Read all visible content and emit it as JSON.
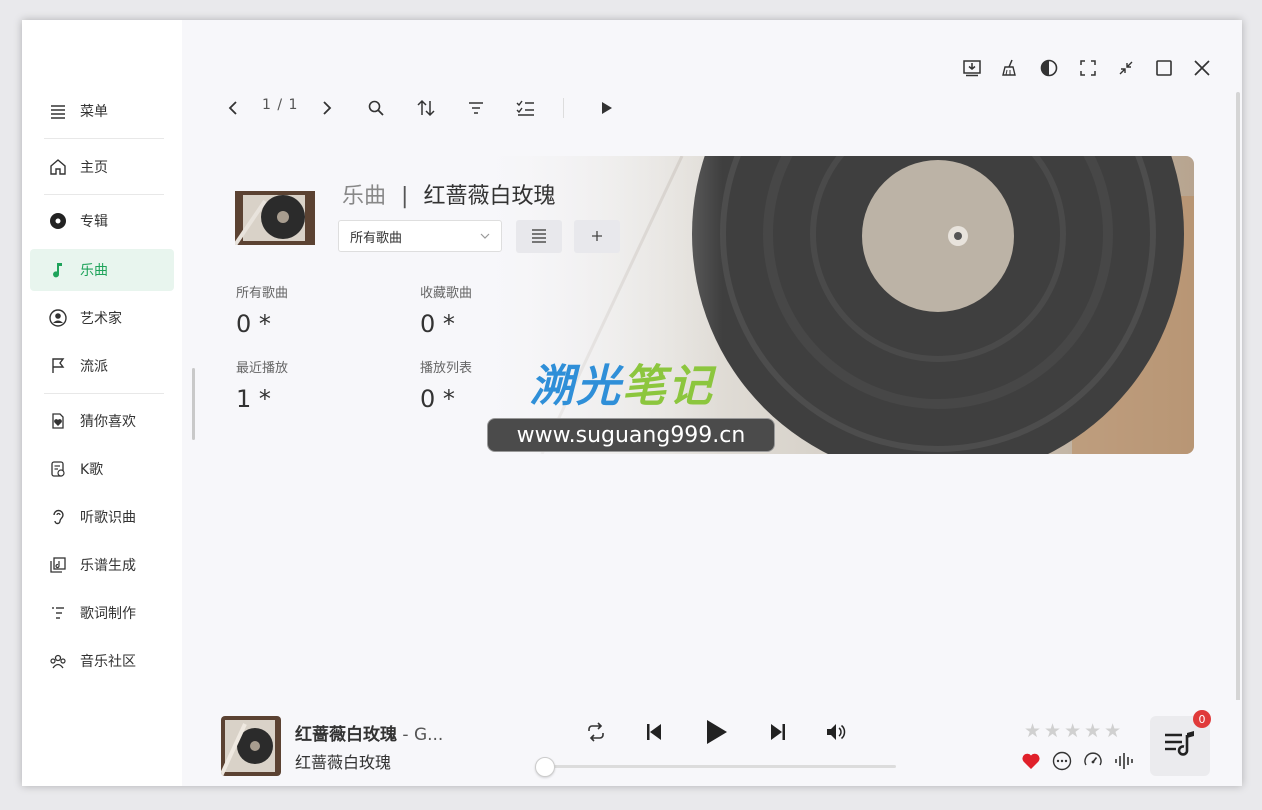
{
  "sidebar": {
    "items": [
      {
        "label": "菜单",
        "icon": "menu-icon"
      },
      {
        "label": "主页",
        "icon": "home-icon"
      },
      {
        "label": "专辑",
        "icon": "album-icon"
      },
      {
        "label": "乐曲",
        "icon": "music-note-icon",
        "active": true
      },
      {
        "label": "艺术家",
        "icon": "artist-icon"
      },
      {
        "label": "流派",
        "icon": "flag-icon"
      },
      {
        "label": "猜你喜欢",
        "icon": "heart-doc-icon"
      },
      {
        "label": "K歌",
        "icon": "karaoke-icon"
      },
      {
        "label": "听歌识曲",
        "icon": "ear-icon"
      },
      {
        "label": "乐谱生成",
        "icon": "score-icon"
      },
      {
        "label": "歌词制作",
        "icon": "lyrics-icon"
      },
      {
        "label": "音乐社区",
        "icon": "community-icon"
      }
    ]
  },
  "toolbar": {
    "page_indicator": "1 / 1"
  },
  "header": {
    "section": "乐曲",
    "separator": "|",
    "name": "红蔷薇白玫瑰"
  },
  "filter": {
    "selected": "所有歌曲"
  },
  "stats": [
    {
      "label": "所有歌曲",
      "value": "0 *"
    },
    {
      "label": "收藏歌曲",
      "value": "0 *"
    },
    {
      "label": "最近播放",
      "value": "1 *"
    },
    {
      "label": "播放列表",
      "value": "0 *"
    }
  ],
  "watermark": {
    "title_part1": "溯光",
    "title_part2": "笔记",
    "url": "www.suguang999.cn"
  },
  "player": {
    "title": "红蔷薇白玫瑰",
    "title_tail": " - G...",
    "artist": "红蔷薇白玫瑰",
    "progress": 0.0,
    "rating_stars": "★★★★★",
    "queue_count": "0"
  },
  "colors": {
    "accent": "#1ea35a",
    "favorite": "#e0202a",
    "badge": "#e03a3a",
    "wm_blue": "#2f8fd8",
    "wm_green": "#8cc63e"
  }
}
